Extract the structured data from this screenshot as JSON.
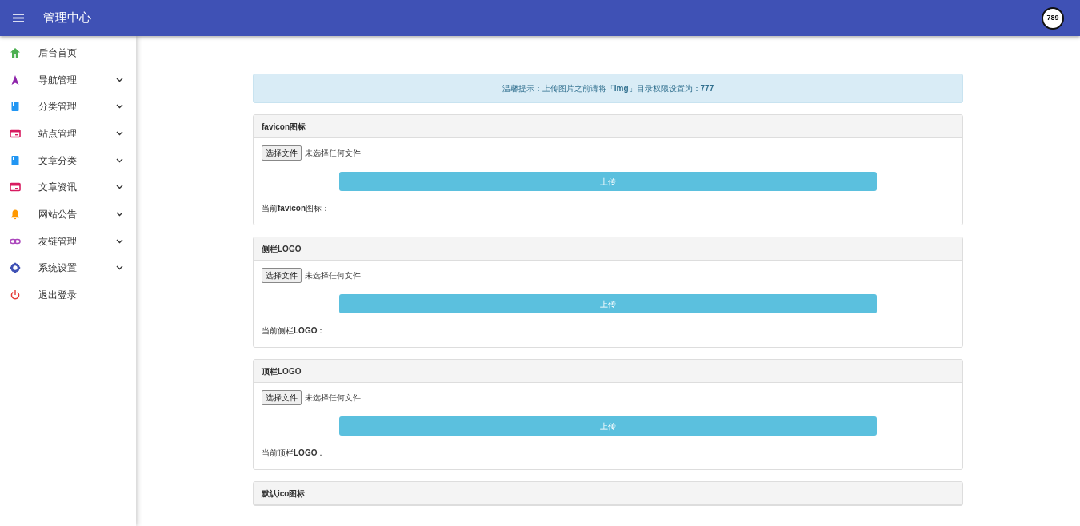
{
  "topbar": {
    "title": "管理中心",
    "avatar_text": "789"
  },
  "sidebar": {
    "items": [
      {
        "label": "后台首页",
        "kind": "home",
        "expandable": false
      },
      {
        "label": "导航管理",
        "kind": "navigation",
        "expandable": true
      },
      {
        "label": "分类管理",
        "kind": "book",
        "expandable": true
      },
      {
        "label": "站点管理",
        "kind": "window",
        "expandable": true
      },
      {
        "label": "文章分类",
        "kind": "book",
        "expandable": true
      },
      {
        "label": "文章资讯",
        "kind": "window",
        "expandable": true
      },
      {
        "label": "网站公告",
        "kind": "bell",
        "expandable": true
      },
      {
        "label": "友链管理",
        "kind": "link",
        "expandable": true
      },
      {
        "label": "系统设置",
        "kind": "gear",
        "expandable": true
      },
      {
        "label": "退出登录",
        "kind": "power",
        "expandable": false
      }
    ]
  },
  "notice": "温馨提示：上传图片之前请将「**img**」目录权限设置为：**777**",
  "sections": [
    {
      "title": "favicon图标",
      "choose_button": "选择文件",
      "file_status": "未选择任何文件",
      "upload_button": "上传",
      "current_label": "当前**favicon**图标："
    },
    {
      "title": "侧栏LOGO",
      "choose_button": "选择文件",
      "file_status": "未选择任何文件",
      "upload_button": "上传",
      "current_label": "当前侧栏**LOGO**："
    },
    {
      "title": "顶栏LOGO",
      "choose_button": "选择文件",
      "file_status": "未选择任何文件",
      "upload_button": "上传",
      "current_label": "当前顶栏**LOGO**："
    },
    {
      "title": "默认ico图标"
    }
  ]
}
